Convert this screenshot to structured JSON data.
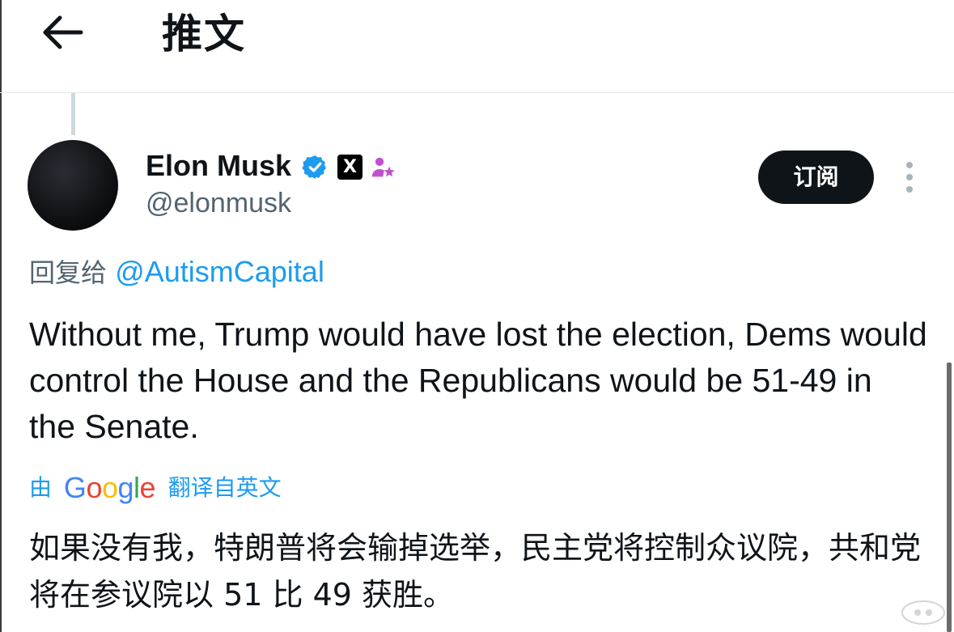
{
  "header": {
    "back_icon": "arrow-left-icon",
    "title": "推文"
  },
  "tweet": {
    "author": {
      "display_name": "Elon Musk",
      "handle": "@elonmusk",
      "verified_icon": "verified-badge-icon",
      "affiliation_badge": "X",
      "affiliation_icon": "x-logo-icon",
      "special_badge_icon": "person-star-icon"
    },
    "subscribe_label": "订阅",
    "more_icon": "more-vertical-icon",
    "reply_prefix": "回复给",
    "reply_to": "@AutismCapital",
    "text": "Without me, Trump would have lost the election, Dems would control the House and the Republicans would be 51-49 in the Senate.",
    "translation": {
      "by_label": "由",
      "provider": "Google",
      "from_label": "翻译自英文",
      "text": "如果没有我，特朗普将会输掉选举，民主党将控制众议院，共和党将在参议院以 51 比 49 获胜。"
    }
  },
  "colors": {
    "link": "#1d9bf0",
    "secondary_text": "#536471",
    "primary_text": "#0f1419",
    "button_bg": "#0f1419",
    "verified": "#1d9bf0",
    "special_badge": "#c24ed0",
    "google": [
      "#4285f4",
      "#ea4335",
      "#fbbc05",
      "#4285f4",
      "#34a853",
      "#ea4335"
    ]
  }
}
